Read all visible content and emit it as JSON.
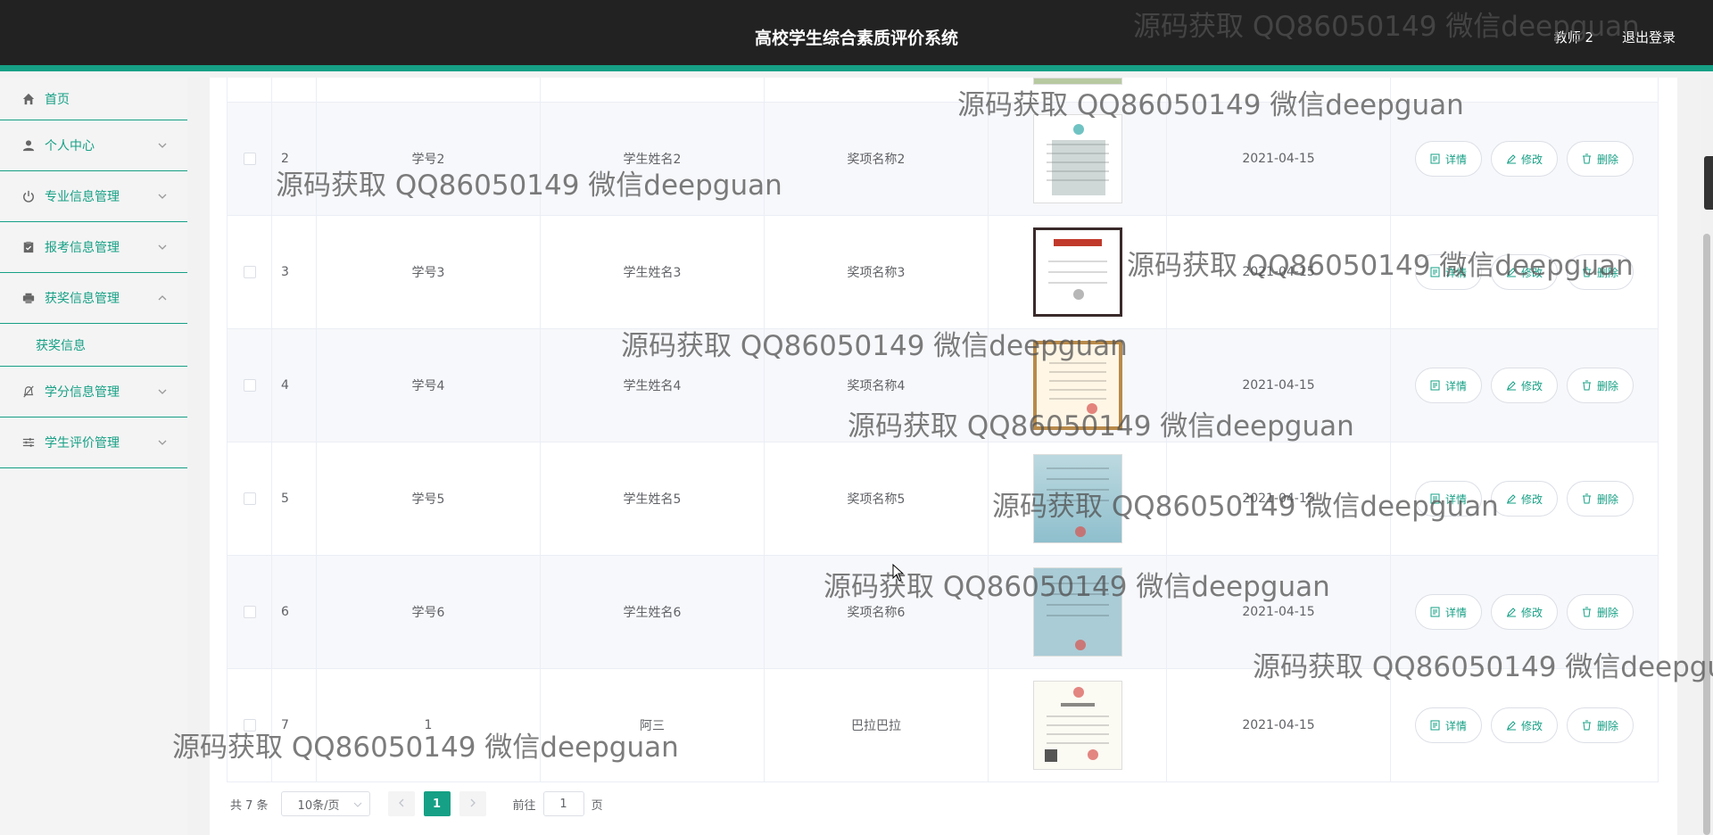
{
  "header": {
    "title": "高校学生综合素质评价系统",
    "user": "教师 2",
    "logout": "退出登录"
  },
  "sidebar": {
    "items": [
      {
        "label": "首页",
        "icon": "home-icon"
      },
      {
        "label": "个人中心",
        "icon": "user-icon"
      },
      {
        "label": "专业信息管理",
        "icon": "power-icon"
      },
      {
        "label": "报考信息管理",
        "icon": "clipboard-icon"
      },
      {
        "label": "获奖信息管理",
        "icon": "printer-icon",
        "expanded": true,
        "children": [
          {
            "label": "获奖信息"
          }
        ]
      },
      {
        "label": "学分信息管理",
        "icon": "bell-off-icon"
      },
      {
        "label": "学生评价管理",
        "icon": "sliders-icon"
      }
    ]
  },
  "table": {
    "rows": [
      {
        "index": "2",
        "student_no": "学号2",
        "student_name": "学生姓名2",
        "award": "奖项名称2",
        "date": "2021-04-15"
      },
      {
        "index": "3",
        "student_no": "学号3",
        "student_name": "学生姓名3",
        "award": "奖项名称3",
        "date": "2021-04-15"
      },
      {
        "index": "4",
        "student_no": "学号4",
        "student_name": "学生姓名4",
        "award": "奖项名称4",
        "date": "2021-04-15"
      },
      {
        "index": "5",
        "student_no": "学号5",
        "student_name": "学生姓名5",
        "award": "奖项名称5",
        "date": "2021-04-15"
      },
      {
        "index": "6",
        "student_no": "学号6",
        "student_name": "学生姓名6",
        "award": "奖项名称6",
        "date": "2021-04-15"
      },
      {
        "index": "7",
        "student_no": "1",
        "student_name": "阿三",
        "award": "巴拉巴拉",
        "date": "2021-04-15"
      }
    ],
    "actions": {
      "detail": "详情",
      "edit": "修改",
      "delete": "删除"
    }
  },
  "pagination": {
    "total": "共 7 条",
    "page_size": "10条/页",
    "current_page": "1",
    "goto_label": "前往",
    "goto_value": "1",
    "page_suffix": "页"
  },
  "watermark": "源码获取 QQ86050149 微信deepguan",
  "colors": {
    "accent": "#16a085",
    "header_bg": "#222222"
  }
}
